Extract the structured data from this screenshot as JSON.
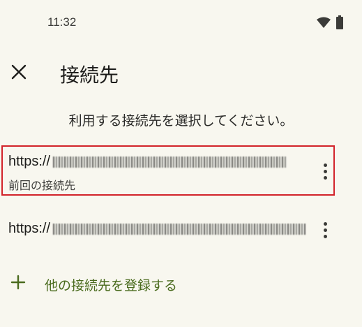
{
  "status_bar": {
    "time": "11:32"
  },
  "header": {
    "title": "接続先"
  },
  "subtitle": "利用する接続先を選択してください。",
  "connections": [
    {
      "url_prefix": "https://",
      "description": "前回の接続先",
      "selected": true
    },
    {
      "url_prefix": "https://",
      "description": ""
    }
  ],
  "add_label": "他の接続先を登録する",
  "colors": {
    "background": "#f8f7ef",
    "accent": "#4a6b1e",
    "highlight_border": "#d2232a"
  }
}
